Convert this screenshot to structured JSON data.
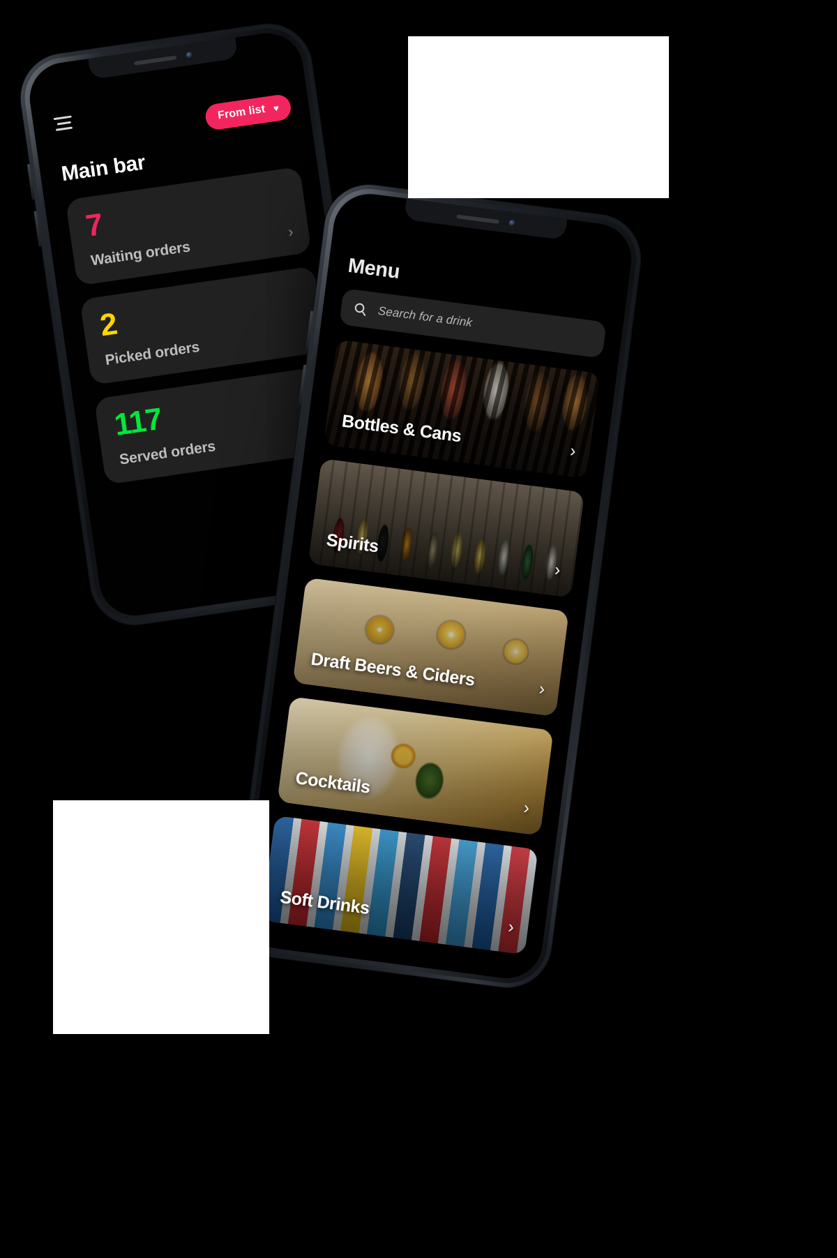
{
  "back_phone": {
    "menu_icon": "hamburger-menu-icon",
    "filter_button": {
      "label": "From list",
      "icon": "heart-icon",
      "glyph": "♥",
      "color": "#F3255E"
    },
    "title": "Main bar",
    "chevron_glyph": "›",
    "stats": [
      {
        "value": "7",
        "label": "Waiting orders",
        "color": "#F3255E"
      },
      {
        "value": "2",
        "label": "Picked orders",
        "color": "#FFD500"
      },
      {
        "value": "117",
        "label": "Served orders",
        "color": "#00E83C"
      }
    ]
  },
  "front_phone": {
    "title": "Menu",
    "search": {
      "placeholder": "Search for a drink",
      "value": "",
      "icon": "search-icon"
    },
    "chevron_glyph": "›",
    "categories": [
      {
        "label": "Bottles & Cans",
        "photo": "ph-bottles"
      },
      {
        "label": "Spirits",
        "photo": "ph-spirits"
      },
      {
        "label": "Draft Beers & Ciders",
        "photo": "ph-draft"
      },
      {
        "label": "Cocktails",
        "photo": "ph-cocktails"
      },
      {
        "label": "Soft Drinks",
        "photo": "ph-soft"
      }
    ]
  }
}
